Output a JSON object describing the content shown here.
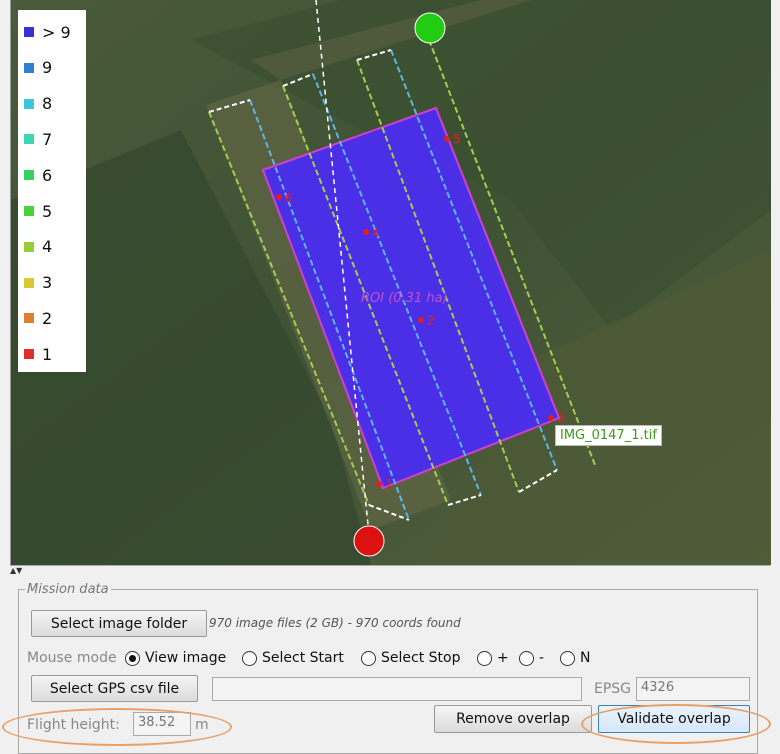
{
  "legend": [
    {
      "label": "> 9",
      "color": "#3b30d6"
    },
    {
      "label": "9",
      "color": "#2f80d0"
    },
    {
      "label": "8",
      "color": "#3cc4dc"
    },
    {
      "label": "7",
      "color": "#3dd6b0"
    },
    {
      "label": "6",
      "color": "#38d060"
    },
    {
      "label": "5",
      "color": "#4cd03a"
    },
    {
      "label": "4",
      "color": "#98cc38"
    },
    {
      "label": "3",
      "color": "#d8c838"
    },
    {
      "label": "2",
      "color": "#dc8030"
    },
    {
      "label": "1",
      "color": "#dc3030"
    }
  ],
  "map": {
    "roi_label": "ROI  (0.31 ha)",
    "tooltip": "IMG_0147_1.tif",
    "point_labels": [
      "1",
      "2",
      "3",
      "4",
      "5",
      "6"
    ],
    "start_marker_color": "#dd1111",
    "end_marker_color": "#22cc11",
    "roi_color": "#4a2fe6"
  },
  "mission": {
    "legend": "Mission data",
    "select_folder_label": "Select image folder",
    "folder_info": "970 image files (2 GB) - 970 coords found",
    "mouse_mode_label": "Mouse mode",
    "modes": [
      "View image",
      "Select Start",
      "Select Stop",
      "+",
      "-",
      "N"
    ],
    "select_gps_label": "Select GPS csv file",
    "gps_path": "",
    "epsg_label": "EPSG",
    "epsg_value": "4326",
    "flight_height_label": "Flight height:",
    "flight_height_value": "38.52",
    "flight_height_unit": "m",
    "remove_overlap_label": "Remove overlap",
    "validate_overlap_label": "Validate overlap"
  }
}
